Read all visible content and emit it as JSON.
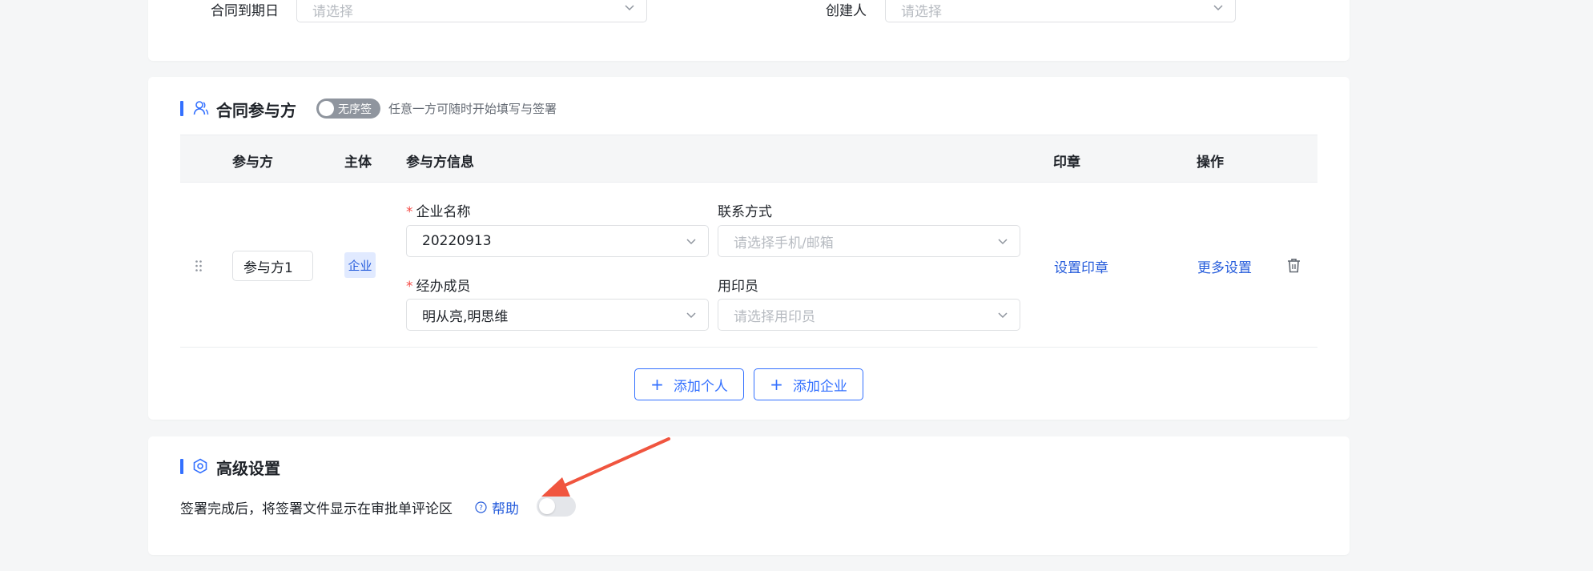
{
  "basic_info": {
    "expiry_label": "合同到期日",
    "expiry_placeholder": "请选择",
    "creator_label": "创建人",
    "creator_placeholder": "请选择"
  },
  "parties": {
    "title": "合同参与方",
    "order_toggle_label": "无序签",
    "order_hint": "任意一方可随时开始填写与签署",
    "columns": [
      "参与方",
      "主体",
      "参与方信息",
      "印章",
      "操作"
    ],
    "row": {
      "party_name": "参与方1",
      "entity_tag": "企业",
      "company_label": "企业名称",
      "company_value": "20220913",
      "contact_label": "联系方式",
      "contact_placeholder": "请选择手机/邮箱",
      "members_label": "经办成员",
      "members_value": "明从亮,明思维",
      "seal_user_label": "用印员",
      "seal_user_placeholder": "请选择用印员",
      "set_seal_link": "设置印章",
      "more_settings_link": "更多设置"
    },
    "add_person_label": "添加个人",
    "add_company_label": "添加企业"
  },
  "advanced": {
    "title": "高级设置",
    "show_file_text": "签署完成后，将签署文件显示在审批单评论区",
    "help_label": "帮助",
    "toggle_state": "off"
  },
  "colors": {
    "accent": "#3370ff",
    "link": "#245bdb",
    "annotation_arrow": "#f0553f"
  }
}
